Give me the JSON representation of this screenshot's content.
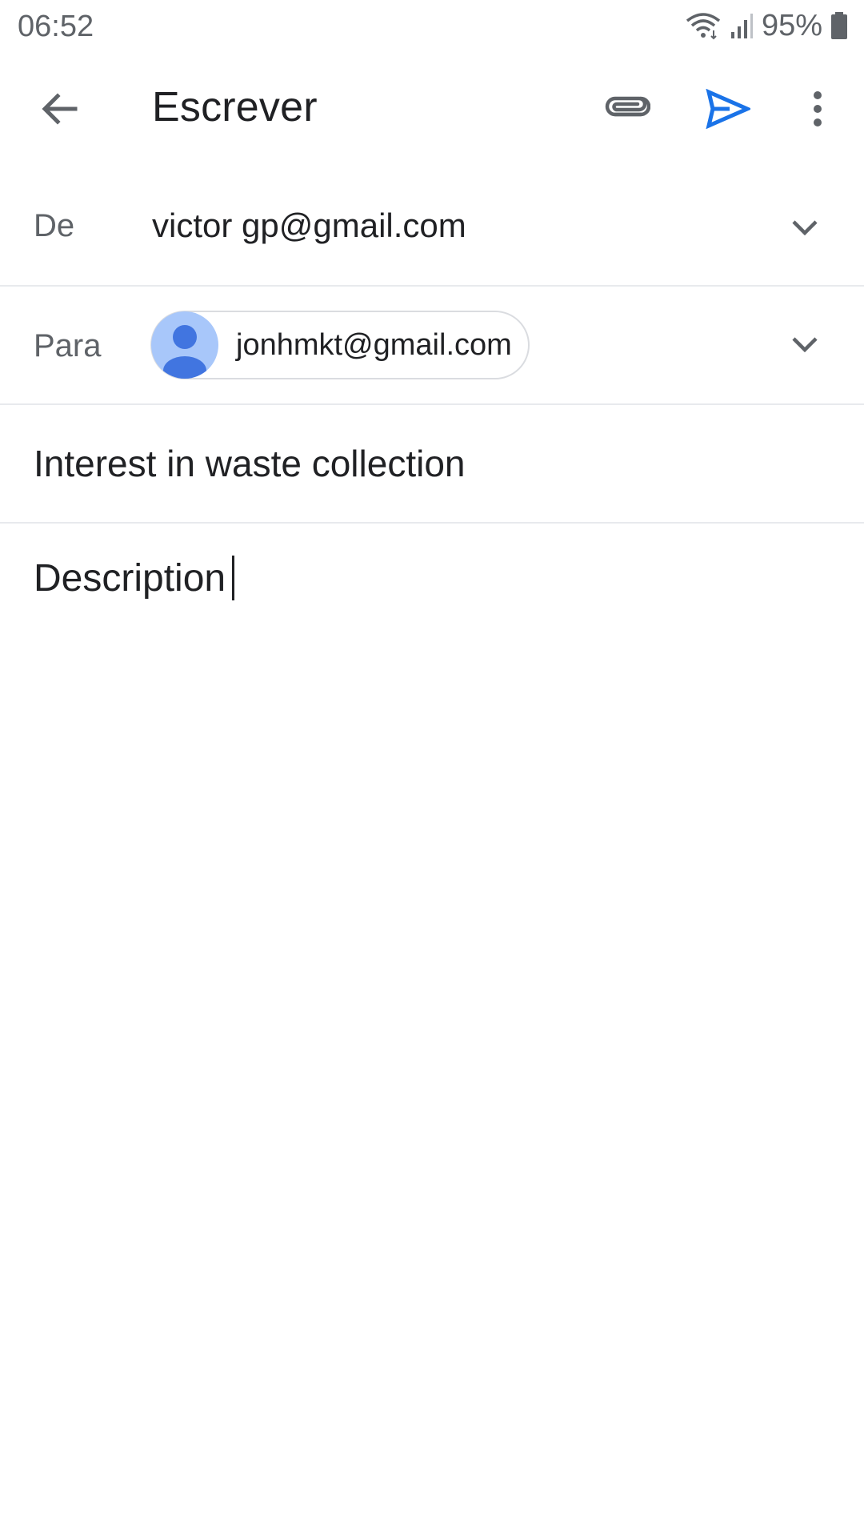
{
  "status_bar": {
    "time": "06:52",
    "battery_percent": "95%",
    "icons": [
      "wifi-icon",
      "signal-icon",
      "battery-icon"
    ]
  },
  "app_bar": {
    "title": "Escrever",
    "icons": [
      "back-arrow-icon",
      "attach-icon",
      "send-icon",
      "more-vert-icon"
    ]
  },
  "from": {
    "label": "De",
    "value": "victor   gp@gmail.com"
  },
  "to": {
    "label": "Para",
    "recipient": "jonhmkt@gmail.com"
  },
  "subject": {
    "value": "Interest in waste collection"
  },
  "body": {
    "value": "Description"
  },
  "colors": {
    "accent": "#1a73e8",
    "icon_gray": "#5f6368",
    "avatar_bg": "#a8c7fa",
    "avatar_fg": "#4285f4",
    "divider": "#e8eaed"
  }
}
